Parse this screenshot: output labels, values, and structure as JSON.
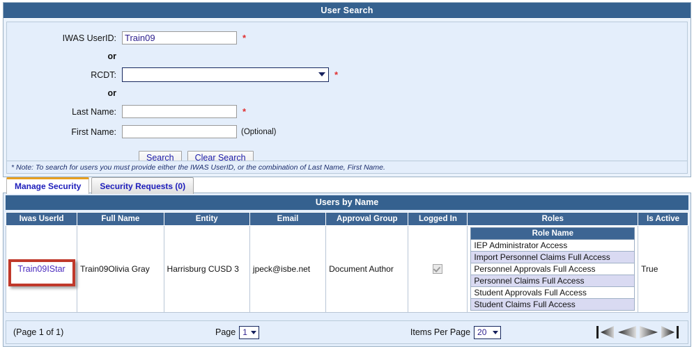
{
  "search_panel": {
    "title": "User Search",
    "fields": {
      "iwas_label": "IWAS UserID:",
      "iwas_value": "Train09",
      "or_1": "or",
      "rcdt_label": "RCDT:",
      "rcdt_value": "",
      "or_2": "or",
      "last_label": "Last Name:",
      "last_value": "",
      "first_label": "First Name:",
      "first_value": "",
      "optional_text": "(Optional)",
      "required_marker": "*"
    },
    "buttons": {
      "search": "Search",
      "clear": "Clear Search"
    },
    "note": "* Note: To search for users you must provide either the IWAS UserID, or the combination of Last Name, First Name."
  },
  "tabs": [
    {
      "label": "Manage Security",
      "active": true
    },
    {
      "label": "Security Requests (0)",
      "active": false
    }
  ],
  "results": {
    "title": "Users by Name",
    "columns": [
      "Iwas UserId",
      "Full Name",
      "Entity",
      "Email",
      "Approval Group",
      "Logged In",
      "Roles",
      "Is Active"
    ],
    "row": {
      "iwas_userid": "Train09IStar",
      "full_name": "Train09Olivia Gray",
      "entity": "Harrisburg CUSD 3",
      "email": "jpeck@isbe.net",
      "approval_group": "Document Author",
      "logged_in_checked": true,
      "is_active": "True",
      "roles_header": "Role Name",
      "roles": [
        "IEP Administrator Access",
        "Import Personnel Claims Full Access",
        "Personnel Approvals Full Access",
        "Personnel Claims Full Access",
        "Student Approvals Full Access",
        "Student Claims Full Access"
      ]
    }
  },
  "pager": {
    "page_info": "(Page 1 of 1)",
    "page_label": "Page",
    "page_value": "1",
    "items_label": "Items Per Page",
    "items_value": "20",
    "nav": {
      "first": "first-page-icon",
      "prev": "previous-page-icon",
      "next": "next-page-icon",
      "last": "last-page-icon"
    }
  },
  "annotation": {
    "color": "#c0392b"
  }
}
